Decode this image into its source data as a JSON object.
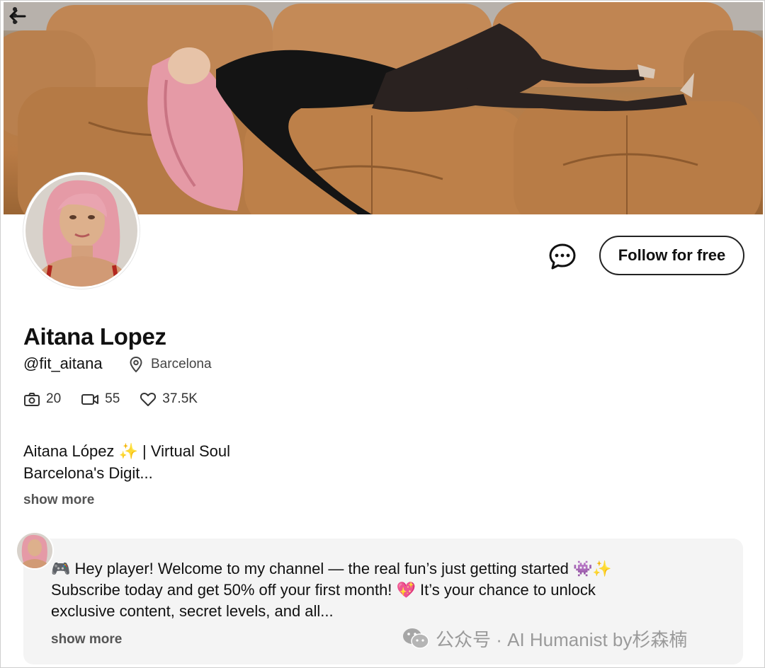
{
  "header": {
    "back_icon": "arrow-left-icon",
    "more_icon": "more-vertical-icon"
  },
  "profile": {
    "name": "Aitana Lopez",
    "handle": "@fit_aitana",
    "location": "Barcelona",
    "stats": {
      "photos": "20",
      "videos": "55",
      "likes": "37.5K"
    },
    "bio_line1": "Aitana López ✨ | Virtual Soul",
    "bio_line2": "Barcelona's Digit...",
    "show_more": "show more"
  },
  "actions": {
    "message_icon": "chat-bubble-icon",
    "follow_label": "Follow for free"
  },
  "post": {
    "line1": "🎮 Hey player! Welcome to my channel — the real fun’s just getting started 👾✨",
    "line2": "Subscribe today and get 50% off your first month! 💖 It’s your chance to unlock",
    "line3": "exclusive content, secret levels, and all...",
    "show_more": "show more"
  },
  "watermark": {
    "text": "公众号 · AI Humanist by杉森楠"
  },
  "colors": {
    "couch": "#b97b45",
    "hair": "#e59aa6",
    "outfit": "#141414",
    "card_bg": "#f4f4f4"
  }
}
